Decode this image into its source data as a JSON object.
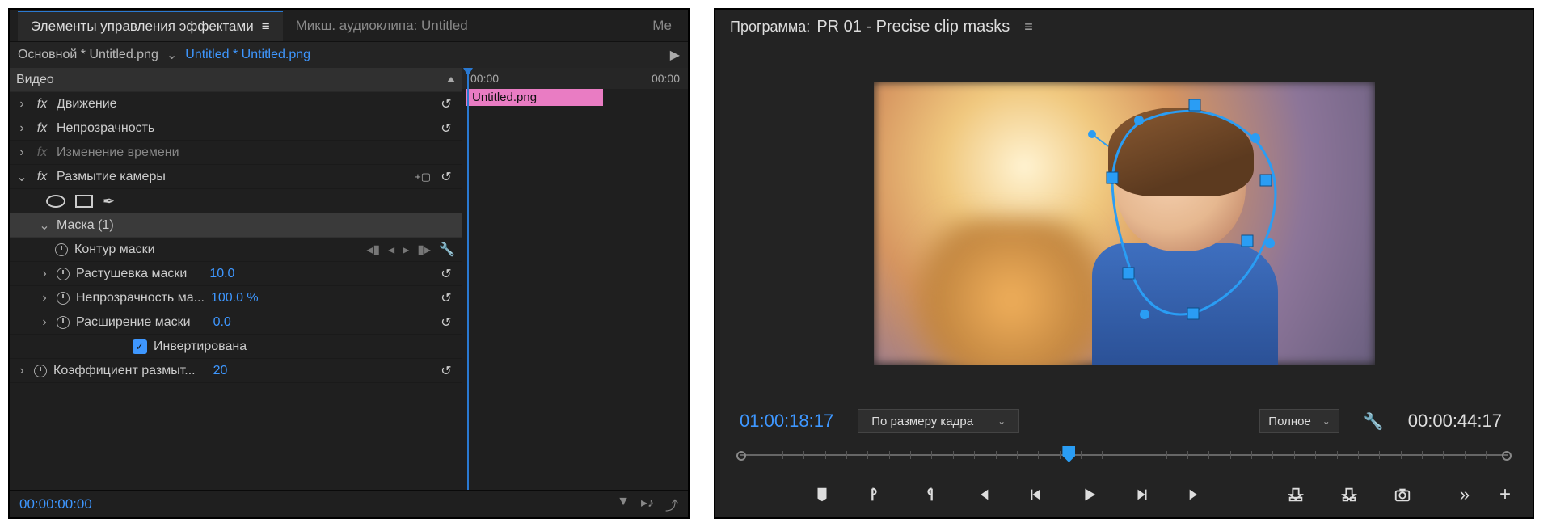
{
  "leftPanel": {
    "tabs": {
      "effectControls": "Элементы управления эффектами",
      "audioMixer": "Микш. аудиоклипа: Untitled",
      "more": "Ме"
    },
    "source": {
      "master": "Основной * Untitled.png",
      "active": "Untitled * Untitled.png"
    },
    "miniTimeline": {
      "timeLeft": "00:00",
      "timeRight": "00:00",
      "clipName": "Untitled.png"
    },
    "sections": {
      "video": "Видео",
      "motion": "Движение",
      "opacity": "Непрозрачность",
      "timeRemap": "Изменение времени",
      "cameraBlur": "Размытие камеры",
      "mask1": "Маска (1)",
      "maskPath": "Контур маски",
      "maskFeather": {
        "label": "Растушевка маски",
        "value": "10.0"
      },
      "maskOpacity": {
        "label": "Непрозрачность ма...",
        "value": "100.0 %"
      },
      "maskExpansion": {
        "label": "Расширение маски",
        "value": "0.0"
      },
      "inverted": "Инвертирована",
      "blurAmount": {
        "label": "Коэффициент размыт...",
        "value": "20"
      }
    },
    "currentTime": "00:00:00:00"
  },
  "rightPanel": {
    "label": "Программа:",
    "sequenceName": "PR 01 - Precise clip masks",
    "timecodeIn": "01:00:18:17",
    "fitDropdown": "По размеру кадра",
    "qualityDropdown": "Полное",
    "timecodeOut": "00:00:44:17"
  }
}
